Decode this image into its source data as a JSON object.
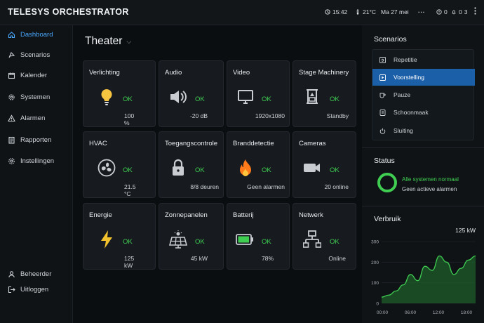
{
  "app": {
    "title": "TELESYS ORCHESTRATOR"
  },
  "topbar": {
    "time": "15:42",
    "temperature": "21°C",
    "date": "Ma 27 mei",
    "more": "...",
    "alarm_count": "0",
    "notif_count": "0",
    "user_count": "3"
  },
  "sidebar": {
    "items": [
      {
        "label": "Dashboard",
        "icon": "home-icon",
        "active": true
      },
      {
        "label": "Scenarios",
        "icon": "scenarios-icon"
      },
      {
        "label": "Kalender",
        "icon": "calendar-icon"
      },
      {
        "label": "Systemen",
        "icon": "gear-icon"
      },
      {
        "label": "Alarmen",
        "icon": "warning-icon"
      },
      {
        "label": "Rapporten",
        "icon": "report-icon"
      },
      {
        "label": "Instellingen",
        "icon": "settings-icon"
      }
    ],
    "bottom": [
      {
        "label": "Beheerder",
        "icon": "user-icon"
      },
      {
        "label": "Uitloggen",
        "icon": "logout-icon"
      }
    ]
  },
  "main": {
    "title": "Theater",
    "tiles": [
      {
        "name": "Verlichting",
        "status": "OK",
        "value": "100 %",
        "icon": "bulb-icon"
      },
      {
        "name": "Audio",
        "status": "OK",
        "value": "-20 dB",
        "icon": "speaker-icon"
      },
      {
        "name": "Video",
        "status": "OK",
        "value": "1920x1080",
        "icon": "monitor-icon"
      },
      {
        "name": "Stage Machinery",
        "status": "OK",
        "value": "Standby",
        "icon": "machinery-icon"
      },
      {
        "name": "HVAC",
        "status": "OK",
        "value": "21.5 °C",
        "icon": "fan-icon"
      },
      {
        "name": "Toegangscontrole",
        "status": "OK",
        "value": "8/8 deuren",
        "icon": "lock-icon"
      },
      {
        "name": "Branddetectie",
        "status": "OK",
        "value": "Geen alarmen",
        "icon": "flame-icon"
      },
      {
        "name": "Cameras",
        "status": "OK",
        "value": "20 online",
        "icon": "camera-icon"
      },
      {
        "name": "Energie",
        "status": "OK",
        "value": "125 kW",
        "icon": "bolt-icon"
      },
      {
        "name": "Zonnepanelen",
        "status": "OK",
        "value": "45 kW",
        "icon": "solar-icon"
      },
      {
        "name": "Batterij",
        "status": "OK",
        "value": "78%",
        "icon": "battery-icon"
      },
      {
        "name": "Netwerk",
        "status": "OK",
        "value": "Online",
        "icon": "network-icon"
      }
    ]
  },
  "scenarios": {
    "title": "Scenarios",
    "items": [
      {
        "label": "Repetitie",
        "icon": "repeat-icon"
      },
      {
        "label": "Voorstelling",
        "icon": "play-icon",
        "active": true
      },
      {
        "label": "Pauze",
        "icon": "cup-icon"
      },
      {
        "label": "Schoonmaak",
        "icon": "clean-icon"
      },
      {
        "label": "Sluiting",
        "icon": "power-icon"
      }
    ]
  },
  "status": {
    "title": "Status",
    "main": "Alle systemen normaal",
    "sub": "Geen actieve alarmen"
  },
  "verbruik": {
    "title": "Verbruik",
    "current": "125 kW"
  },
  "chart_data": {
    "type": "area",
    "x": [
      "00:00",
      "01:30",
      "03:00",
      "04:30",
      "06:00",
      "07:30",
      "09:00",
      "10:30",
      "12:00",
      "13:30",
      "15:00",
      "16:30",
      "18:00",
      "19:30"
    ],
    "series": [
      {
        "values": [
          30,
          40,
          60,
          90,
          140,
          110,
          180,
          160,
          230,
          200,
          140,
          170,
          210,
          230
        ]
      }
    ],
    "xticks": [
      "00:00",
      "06:00",
      "12:00",
      "18:00"
    ],
    "yticks": [
      "0",
      "100",
      "200",
      "300"
    ],
    "ylim": [
      0,
      300
    ],
    "grid": true,
    "colors": {
      "line": "#3fce52",
      "fill": "#1d5d2a"
    }
  },
  "colors": {
    "accent": "#4aa8ff",
    "ok": "#3fce52",
    "active_bg": "#1b5fa8",
    "battery": "#3fce52",
    "bolt": "#f2c12e",
    "bulb": "#f5c542",
    "flame": "#ff7a1a"
  }
}
